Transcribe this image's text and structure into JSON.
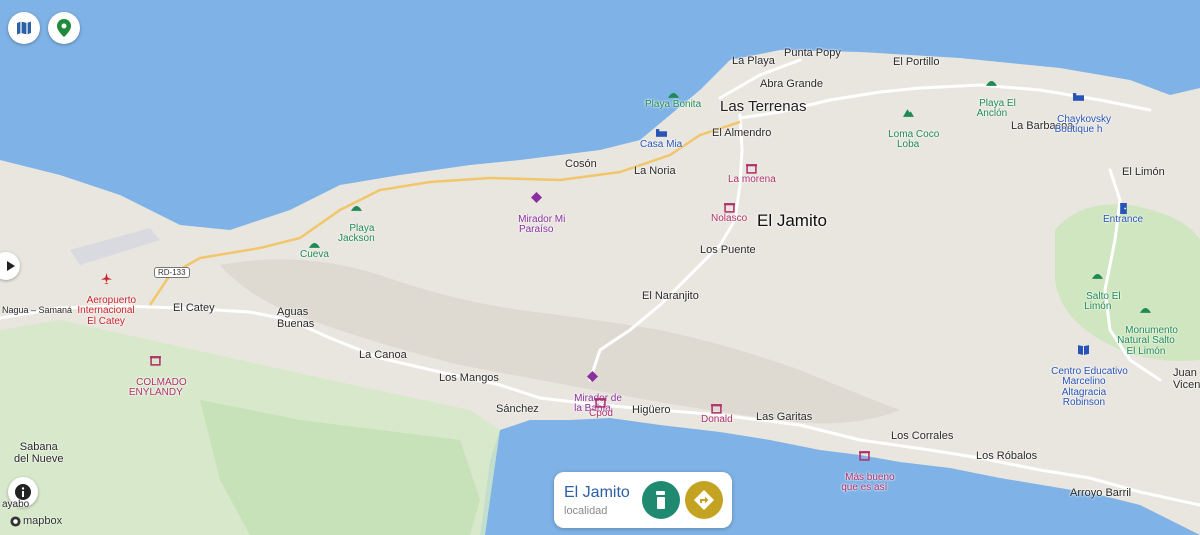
{
  "colors": {
    "water": "#7fb2e6",
    "land": "#e9e6df",
    "forest": "#bfe0b0",
    "road": "#ffffff",
    "highway": "#f2c66a",
    "accent": "#2b5fa8"
  },
  "controls": {
    "map_style": "map-icon",
    "location": "location-pin-icon",
    "expand": "play-icon",
    "info": "info-icon"
  },
  "road_shield": "RD-133",
  "road_name": "Nagua – Samaná",
  "towns": {
    "la_playa": "La Playa",
    "punta_popy": "Punta Popy",
    "el_portillo": "El Portillo",
    "abra_grande": "Abra Grande",
    "las_terrenas": "Las Terrenas",
    "el_almendro": "El Almendro",
    "la_barbacoa": "La Barbacoa",
    "coson": "Cosón",
    "la_noria": "La Noria",
    "el_jamito": "El Jamito",
    "el_limon": "El Limón",
    "los_puente": "Los Puente",
    "el_naranjito": "El Naranjito",
    "el_catey": "El Catey",
    "aguas_buenas": "Aguas\nBuenas",
    "la_canoa": "La Canoa",
    "los_mangos": "Los Mangos",
    "sanchez": "Sánchez",
    "higuero": "Higüero",
    "las_garitas": "Las Garitas",
    "los_corrales": "Los Corrales",
    "los_roblas": "Los Róbalos",
    "arroyo_barril": "Arroyo Barril",
    "sabana": "Sabana\ndel Nueve",
    "juan_vicente": "Juan\nVicen",
    "guayabo": "ayabo"
  },
  "pois": {
    "playa_bonita": "Playa Bonita",
    "casa_mia": "Casa Mia",
    "loma_coco": "Loma Coco\nLoba",
    "playa_ancon": "Playa El\nAnclón",
    "chaykovsky": "Chaykovsky\nBoutique h",
    "la_morena": "La morena",
    "nolasco": "Nolasco",
    "mirador_paraiso": "Mirador Mi\nParaíso",
    "playa_jackson": "Playa\nJackson",
    "cueva": "Cueva",
    "aeropuerto": "Aeropuerto\nInternacional\nEl Catey",
    "colmado": "COLMADO\nENYLANDY",
    "mirador_bahia": "Mirador de\nla Bahía",
    "cpod": "Cpod",
    "donald": "Donald",
    "mas_bueno": "Más bueno\nque es así",
    "entrance": "Entrance",
    "salto": "Salto El\nLimón",
    "monumento": "Monumento\nNatural Salto\nEl Limón",
    "centro": "Centro Educativo\nMarcelino\nAltagracia\nRobinson"
  },
  "card": {
    "title": "El Jamito",
    "subtitle": "localidad",
    "info_color": "#1f8a70",
    "directions_color": "#c4a322"
  },
  "attribution": "mapbox"
}
